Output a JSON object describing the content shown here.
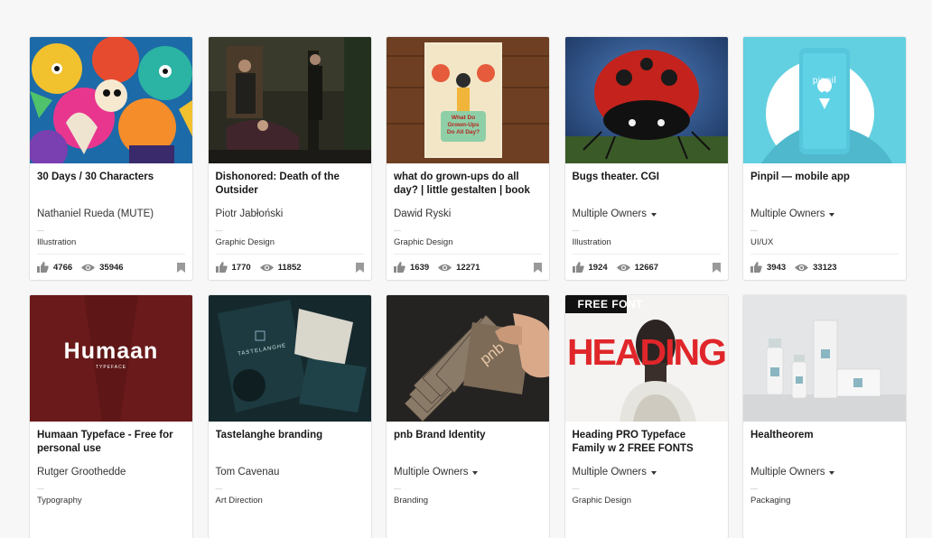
{
  "colors": {
    "page_bg": "#f7f7f7",
    "card_bg": "#ffffff",
    "stat_icon": "#8a8a8a"
  },
  "projects": [
    {
      "title": "30 Days / 30 Characters",
      "owner": "Nathaniel Rueda (MUTE)",
      "owner_menu": false,
      "field": "Illustration",
      "likes": "4766",
      "views": "35946"
    },
    {
      "title": "Dishonored: Death of the Outsider",
      "owner": "Piotr Jabłoński",
      "owner_menu": false,
      "field": "Graphic Design",
      "likes": "1770",
      "views": "11852"
    },
    {
      "title": "what do grown-ups do all day? | little gestalten | book",
      "owner": "Dawid Ryski",
      "owner_menu": false,
      "field": "Graphic Design",
      "likes": "1639",
      "views": "12271"
    },
    {
      "title": "Bugs theater. CGI",
      "owner": "Multiple Owners",
      "owner_menu": true,
      "field": "Illustration",
      "likes": "1924",
      "views": "12667"
    },
    {
      "title": "Pinpil — mobile app",
      "owner": "Multiple Owners",
      "owner_menu": true,
      "field": "UI/UX",
      "likes": "3943",
      "views": "33123"
    },
    {
      "title": "Humaan Typeface - Free for personal use",
      "owner": "Rutger Groothedde",
      "owner_menu": false,
      "field": "Typography",
      "likes": "",
      "views": ""
    },
    {
      "title": "Tastelanghe branding",
      "owner": "Tom Cavenau",
      "owner_menu": false,
      "field": "Art Direction",
      "likes": "",
      "views": ""
    },
    {
      "title": "pnb Brand Identity",
      "owner": "Multiple Owners",
      "owner_menu": true,
      "field": "Branding",
      "likes": "",
      "views": ""
    },
    {
      "title": "Heading PRO Typeface Family w 2 FREE FONTS",
      "owner": "Multiple Owners",
      "owner_menu": true,
      "field": "Graphic Design",
      "likes": "",
      "views": ""
    },
    {
      "title": "Healtheorem",
      "owner": "Multiple Owners",
      "owner_menu": true,
      "field": "Packaging",
      "likes": "",
      "views": ""
    }
  ],
  "thumb_text": {
    "book_cover": "What Do Grown-Ups Do All Day?",
    "pinpil_logo": "pinpil",
    "humaan_logo": "Humaan",
    "humaan_sub": "TYPEFACE",
    "tastelanghe_logo": "TASTELANGHE",
    "pnb_logo": "pnb",
    "free_font": "FREE FONT",
    "heading_word": "HEADING"
  }
}
